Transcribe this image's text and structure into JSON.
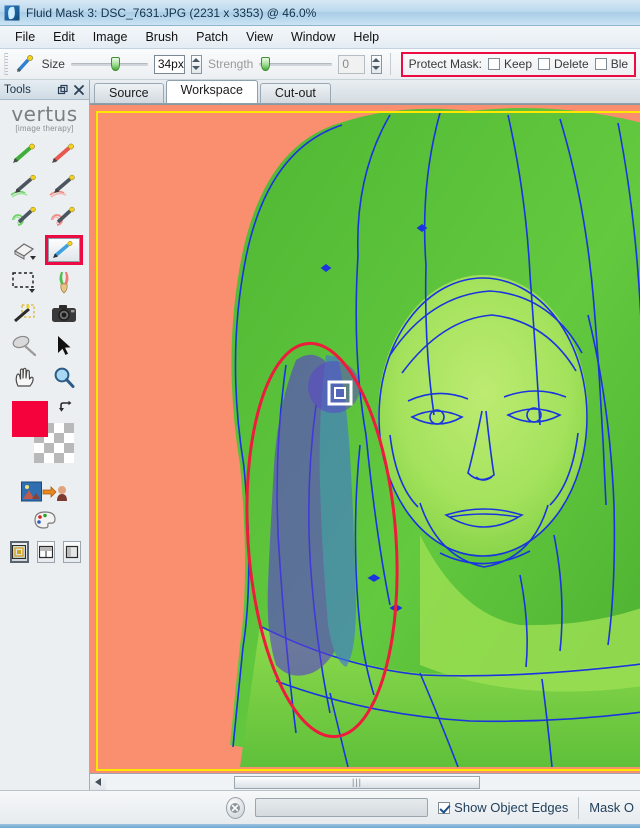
{
  "window": {
    "title": "Fluid Mask 3: DSC_7631.JPG (2231 x 3353) @ 46.0%",
    "icon": "app-logo-icon"
  },
  "menu": {
    "items": [
      {
        "label": "File"
      },
      {
        "label": "Edit"
      },
      {
        "label": "Image"
      },
      {
        "label": "Brush"
      },
      {
        "label": "Patch"
      },
      {
        "label": "View"
      },
      {
        "label": "Window"
      },
      {
        "label": "Help"
      }
    ]
  },
  "toolbar": {
    "active_tool_icon": "pen-icon",
    "size_label": "Size",
    "size_value": "34px",
    "strength_label": "Strength",
    "strength_value": "0",
    "protect_mask": {
      "label": "Protect Mask:",
      "highlight_color": "#ec0b43",
      "options": [
        {
          "label": "Keep",
          "checked": false
        },
        {
          "label": "Delete",
          "checked": false
        },
        {
          "label": "Ble",
          "checked": false
        }
      ]
    }
  },
  "tools_panel": {
    "header_title": "Tools",
    "undock_icon": "undock-icon",
    "close_icon": "close-icon",
    "brand_name": "vertus",
    "brand_tagline": "[image therapy]",
    "tools": [
      {
        "name": "keep-pen-tool",
        "icon": "green-pen-icon",
        "selected": false
      },
      {
        "name": "delete-pen-tool",
        "icon": "red-pen-icon",
        "selected": false
      },
      {
        "name": "keep-blend-brush-tool",
        "icon": "green-blend-pen-icon",
        "selected": false
      },
      {
        "name": "delete-blend-brush-tool",
        "icon": "red-blend-pen-icon",
        "selected": false
      },
      {
        "name": "keep-fill-tool",
        "icon": "green-spiral-pen-icon",
        "selected": false
      },
      {
        "name": "delete-fill-tool",
        "icon": "red-spiral-pen-icon",
        "selected": false
      },
      {
        "name": "eraser-tool",
        "icon": "eraser-icon",
        "selected": false
      },
      {
        "name": "blend-pen-tool",
        "icon": "blue-pen-icon",
        "selected": true
      },
      {
        "name": "marquee-tool",
        "icon": "marquee-icon",
        "selected": false
      },
      {
        "name": "feather-pen-tool",
        "icon": "feather-pen-icon",
        "selected": false
      },
      {
        "name": "magic-wand-tool",
        "icon": "magic-wand-icon",
        "selected": false
      },
      {
        "name": "camera-tool",
        "icon": "camera-icon",
        "selected": false
      },
      {
        "name": "dropper-tool",
        "icon": "spoon-dropper-icon",
        "selected": false
      },
      {
        "name": "pointer-tool",
        "icon": "arrow-cursor-icon",
        "selected": false
      },
      {
        "name": "hand-tool",
        "icon": "hand-icon",
        "selected": false
      },
      {
        "name": "zoom-tool",
        "icon": "magnifier-icon",
        "selected": false
      }
    ],
    "swatches": {
      "foreground_color": "#f5023c",
      "background": "transparent-checker",
      "swap_icon": "swap-colors-icon"
    },
    "extra_tools": [
      {
        "name": "transform-image-tool",
        "icon": "photo-transform-icon"
      },
      {
        "name": "palette-tool",
        "icon": "color-palette-icon"
      }
    ],
    "view_modes": [
      {
        "name": "view-mode-single",
        "icon": "single-view-icon",
        "active": true
      },
      {
        "name": "view-mode-split-horizontal",
        "icon": "split-horizontal-icon",
        "active": false
      },
      {
        "name": "view-mode-blank",
        "icon": "blank-view-icon",
        "active": false
      }
    ]
  },
  "tabs": [
    {
      "label": "Source",
      "active": false
    },
    {
      "label": "Workspace",
      "active": true
    },
    {
      "label": "Cut-out",
      "active": false
    }
  ],
  "canvas": {
    "background_color": "#f98f6e",
    "mask_color": "#5cc03a",
    "mask_highlight_color": "#a8e05a",
    "edge_color": "#1a34e0",
    "brush_stroke_color": "#6b4fd8",
    "annotation_color": "#ee1c3c",
    "selection_frame_color": "#ffe800",
    "cursor_icon": "square-brush-cursor"
  },
  "scrollbar": {
    "left_arrow_icon": "scroll-left-arrow-icon",
    "thumb_grip": "|||"
  },
  "statusbar": {
    "stop_icon": "stop-cancel-icon",
    "progress_value": "",
    "show_object_edges": {
      "label": "Show Object Edges",
      "checked": true
    },
    "mask_label": "Mask O"
  }
}
